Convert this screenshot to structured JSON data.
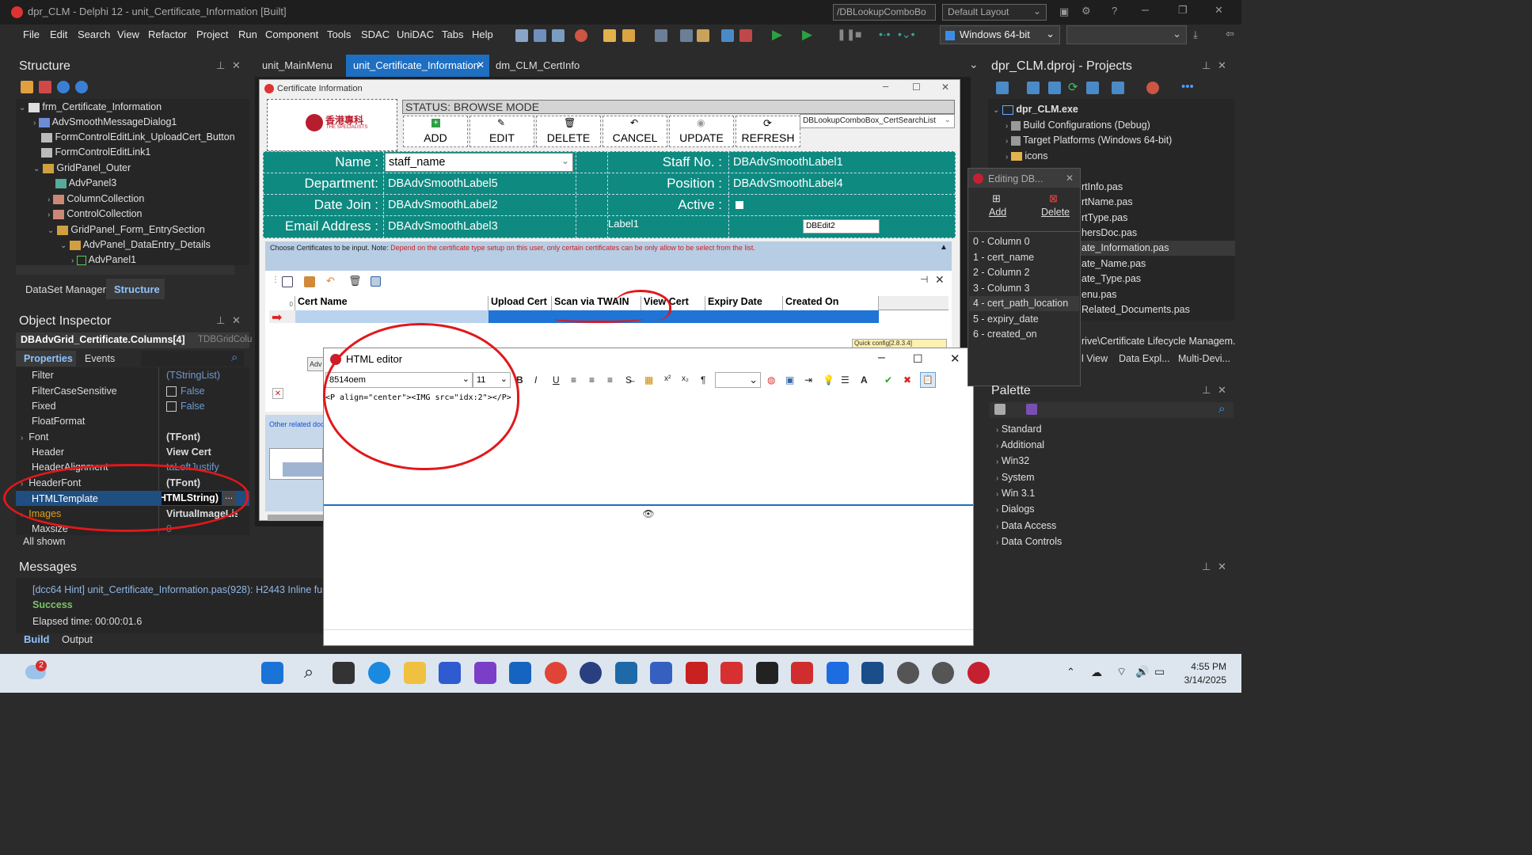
{
  "window": {
    "title": "dpr_CLM - Delphi 12 - unit_Certificate_Information [Built]",
    "search_value": "/DBLookupComboBo",
    "layout_select": "Default Layout"
  },
  "menu": [
    "File",
    "Edit",
    "Search",
    "View",
    "Refactor",
    "Project",
    "Run",
    "Component",
    "Tools",
    "SDAC",
    "UniDAC",
    "Tabs",
    "Help"
  ],
  "platform_select": "Windows 64-bit",
  "editor_tabs": [
    "unit_MainMenu",
    "unit_Certificate_Information",
    "dm_CLM_CertInfo"
  ],
  "structure": {
    "title": "Structure",
    "items": [
      "frm_Certificate_Information",
      "AdvSmoothMessageDialog1",
      "FormControlEditLink_UploadCert_Button",
      "FormControlEditLink1",
      "GridPanel_Outer",
      "AdvPanel3",
      "ColumnCollection",
      "ControlCollection",
      "GridPanel_Form_EntrySection",
      "AdvPanel_DataEntry_Details",
      "AdvPanel1"
    ],
    "tabs": [
      "DataSet Manager",
      "Structure"
    ]
  },
  "object_inspector": {
    "title": "Object Inspector",
    "selected": "DBAdvGrid_Certificate.Columns[4]",
    "selected_type": "TDBGridColu",
    "tabs": [
      "Properties",
      "Events"
    ],
    "props": [
      {
        "name": "Filter",
        "value": "(TStringList)"
      },
      {
        "name": "FilterCaseSensitive",
        "value": "False"
      },
      {
        "name": "Fixed",
        "value": "False"
      },
      {
        "name": "FloatFormat",
        "value": ""
      },
      {
        "name": "Font",
        "value": "(TFont)"
      },
      {
        "name": "Header",
        "value": "View Cert"
      },
      {
        "name": "HeaderAlignment",
        "value": "taLeftJustify"
      },
      {
        "name": "HeaderFont",
        "value": "(TFont)"
      },
      {
        "name": "HTMLTemplate",
        "value": "(HTMLString)"
      },
      {
        "name": "Images",
        "value": "VirtualImageList"
      },
      {
        "name": "Maxsize",
        "value": "0"
      }
    ],
    "footer": "All shown"
  },
  "messages": {
    "title": "Messages",
    "lines": [
      "[dcc64 Hint] unit_Certificate_Information.pas(928): H2443 Inline funct",
      "Success",
      "Elapsed time: 00:00:01.6"
    ],
    "tabs": [
      "Build",
      "Output"
    ]
  },
  "form": {
    "title": "Certificate Information",
    "logo_text": "香港專科",
    "logo_sub": "THE SPECIALISTS",
    "status": "STATUS: BROWSE MODE",
    "buttons": [
      "ADD",
      "EDIT",
      "DELETE",
      "CANCEL",
      "UPDATE",
      "REFRESH"
    ],
    "lookup": "DBLookupComboBox_CertSearchList",
    "fields": {
      "name_label": "Name :",
      "name_value": "staff_name",
      "staff_label": "Staff No. :",
      "staff_value": "DBAdvSmoothLabel1",
      "dept_label": "Department:",
      "dept_value": "DBAdvSmoothLabel5",
      "pos_label": "Position :",
      "pos_value": "DBAdvSmoothLabel4",
      "date_label": "Date Join :",
      "date_value": "DBAdvSmoothLabel2",
      "active_label": "Active :",
      "email_label": "Email Address :",
      "email_value": "DBAdvSmoothLabel3",
      "label1": "Label1",
      "dbedit2": "DBEdit2"
    },
    "choose_note_prefix": "Choose Certificates to be input. Note: ",
    "choose_note": "Depend on the certificate type setup on this user, only certain certificates can be only allow to be select from the list.",
    "grid_headers": [
      "Cert Name",
      "Upload Cert",
      "Scan via TWAIN",
      "View Cert",
      "Expiry Date",
      "Created On"
    ],
    "quick_config": "Quick config[2.8.3.4]",
    "other_related": "Other related doc",
    "adv_label": "Adv"
  },
  "html_editor": {
    "title": "HTML editor",
    "font_name": "8514oem",
    "font_size": "11",
    "content": "<P align=\"center\"><IMG src=\"idx:2\"></P>"
  },
  "column_editor": {
    "title": "Editing DB...",
    "add": "Add",
    "delete": "Delete",
    "items": [
      "0 - Column 0",
      "1 - cert_name",
      "2 - Column 2",
      "3 - Column 3",
      "4 - cert_path_location",
      "5 - expiry_date",
      "6 - created_on"
    ]
  },
  "projects": {
    "title": "dpr_CLM.dproj - Projects",
    "items": [
      "dpr_CLM.exe",
      "Build Configurations (Debug)",
      "Target Platforms (Windows 64-bit)",
      "icons"
    ],
    "files": [
      "rtInfo.pas",
      "rtName.pas",
      "rtType.pas",
      "hersDoc.pas",
      "ate_Information.pas",
      "ate_Name.pas",
      "ate_Type.pas",
      "enu.pas",
      "Related_Documents.pas"
    ],
    "path": "rive\\Certificate Lifecycle Managem...",
    "bottom_tabs": [
      "l View",
      "Data Expl...",
      "Multi-Devi..."
    ]
  },
  "palette": {
    "title": "Palette",
    "items": [
      "Standard",
      "Additional",
      "Win32",
      "System",
      "Win 3.1",
      "Dialogs",
      "Data Access",
      "Data Controls"
    ]
  },
  "taskbar": {
    "time": "4:55 PM",
    "date": "3/14/2025",
    "weather_badge": "2"
  }
}
